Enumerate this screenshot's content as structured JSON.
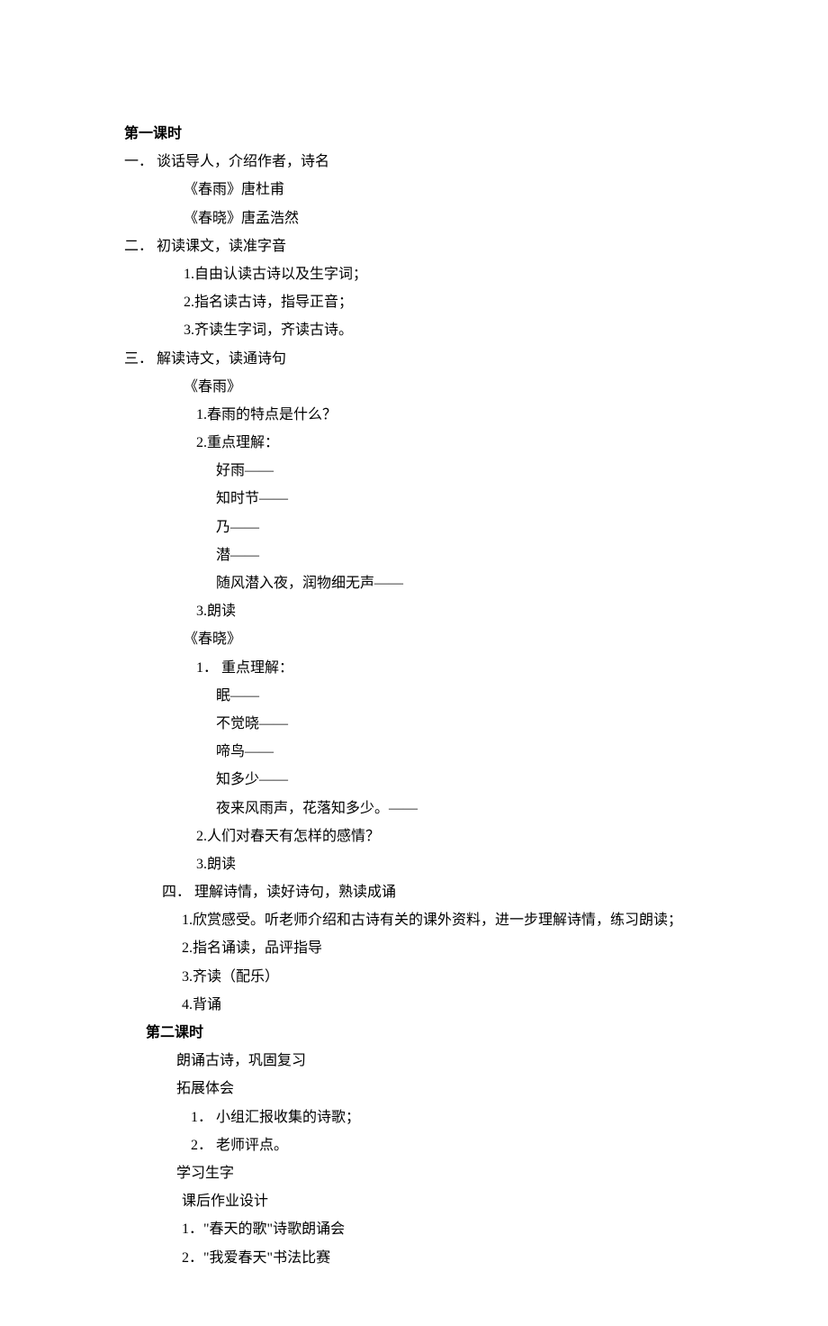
{
  "lesson1": {
    "title": "第一课时",
    "section1": {
      "heading": "一． 谈话导人，介绍作者，诗名",
      "items": [
        "《春雨》唐杜甫",
        "《春晓》唐孟浩然"
      ]
    },
    "section2": {
      "heading": "二． 初读课文，读准字音",
      "items": [
        "1.自由认读古诗以及生字词；",
        "2.指名读古诗，指导正音；",
        "3.齐读生字词，齐读古诗。"
      ]
    },
    "section3": {
      "heading": "三． 解读诗文，读通诗句",
      "poem1": {
        "title": "《春雨》",
        "items": [
          "1.春雨的特点是什么？",
          "2.重点理解："
        ],
        "terms": [
          "好雨——",
          "知时节——",
          "乃——",
          "潜——",
          "随风潜入夜，润物细无声——"
        ],
        "item3": "3.朗读"
      },
      "poem2": {
        "title": "《春晓》",
        "item1": "1． 重点理解：",
        "terms": [
          "眠——",
          "不觉晓——",
          "啼鸟——",
          "知多少——",
          "夜来风雨声，花落知多少。——"
        ],
        "item2": "2.人们对春天有怎样的感情？",
        "item3": "3.朗读"
      }
    },
    "section4": {
      "heading": "四． 理解诗情，读好诗句，熟读成诵",
      "items": [
        "1.欣赏感受。听老师介绍和古诗有关的课外资料，进一步理解诗情，练习朗读；",
        "2.指名诵读，品评指导",
        "3.齐读（配乐）",
        "4.背诵"
      ]
    }
  },
  "lesson2": {
    "title": "第二课时",
    "items": [
      "朗诵古诗，巩固复习",
      "拓展体会"
    ],
    "subitems": [
      "1． 小组汇报收集的诗歌；",
      "2． 老师评点。"
    ],
    "items2": [
      "学习生字",
      "课后作业设计"
    ],
    "hw": [
      "1．\"春天的歌\"诗歌朗诵会",
      "2．\"我爱春天\"书法比赛"
    ]
  }
}
